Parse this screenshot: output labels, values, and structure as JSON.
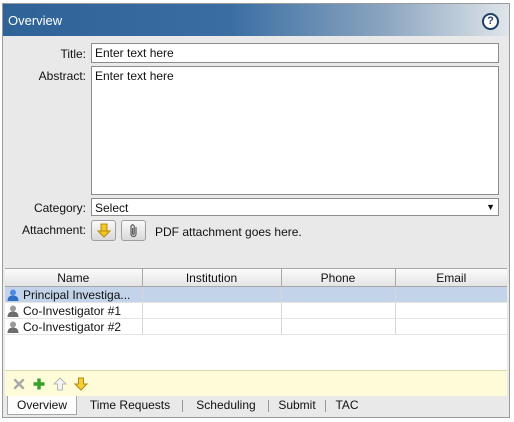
{
  "window": {
    "title": "Overview",
    "help_glyph": "?"
  },
  "form": {
    "title_label": "Title:",
    "title_value": "Enter text here",
    "abstract_label": "Abstract:",
    "abstract_value": "Enter text here",
    "category_label": "Category:",
    "category_value": "Select",
    "attachment_label": "Attachment:",
    "attachment_text": "PDF attachment goes here."
  },
  "table": {
    "columns": [
      "Name",
      "Institution",
      "Phone",
      "Email"
    ],
    "rows": [
      {
        "name": "Principal Investiga...",
        "institution": "",
        "phone": "",
        "email": "",
        "selected": true,
        "icon": "person-blue-icon"
      },
      {
        "name": "Co-Investigator #1",
        "institution": "",
        "phone": "",
        "email": "",
        "selected": false,
        "icon": "person-gray-icon"
      },
      {
        "name": "Co-Investigator #2",
        "institution": "",
        "phone": "",
        "email": "",
        "selected": false,
        "icon": "person-gray-icon"
      }
    ]
  },
  "toolbar": {
    "icons": [
      "remove-icon",
      "add-icon",
      "move-up-icon",
      "move-down-icon"
    ]
  },
  "tabs": [
    "Overview",
    "Time Requests",
    "Scheduling",
    "Submit",
    "TAC"
  ],
  "colors": {
    "titlebar": "#2f6397",
    "selection": "#c3d4ea",
    "toolbar_bg": "#fdfbd8"
  }
}
